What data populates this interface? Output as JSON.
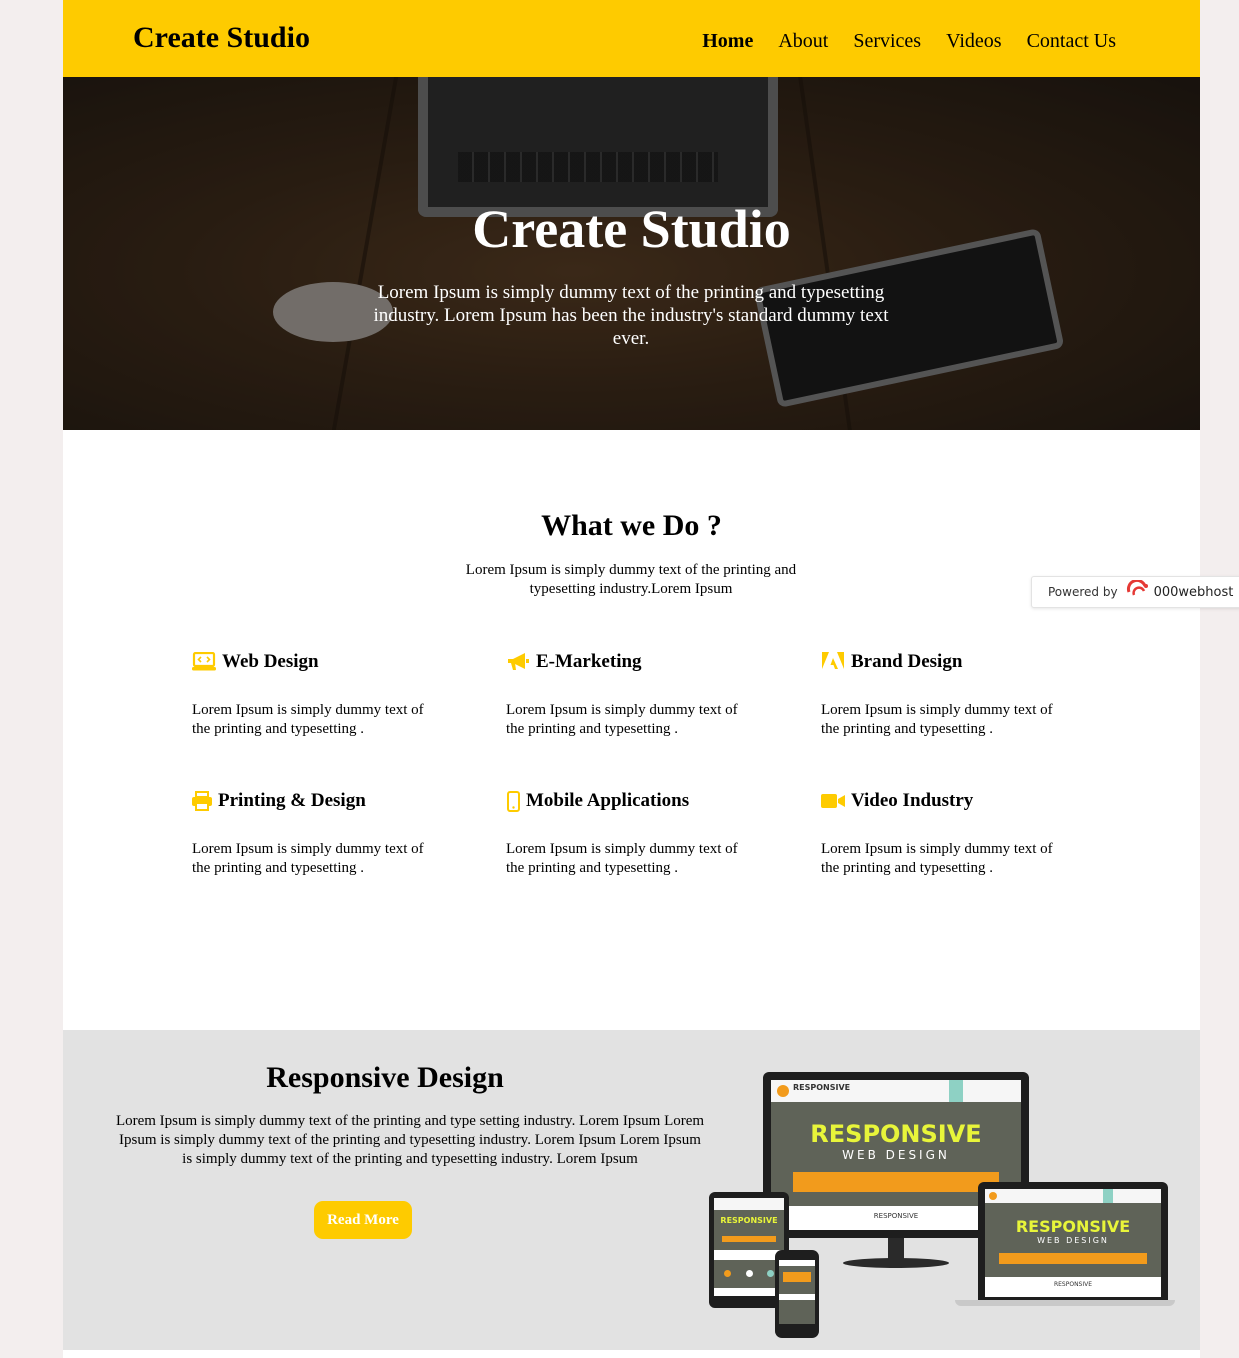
{
  "header": {
    "brand": "Create Studio",
    "nav": [
      "Home",
      "About",
      "Services",
      "Videos",
      "Contact Us"
    ],
    "active": "Home"
  },
  "hero": {
    "title": "Create Studio",
    "text": "Lorem Ipsum is simply dummy text of the printing and typesetting industry. Lorem Ipsum has been the industry's standard dummy text ever."
  },
  "what_we_do": {
    "title": "What we Do ?",
    "subtitle": "Lorem Ipsum is simply dummy text of the printing and typesetting industry.Lorem Ipsum",
    "services": [
      {
        "title": "Web Design",
        "icon": "laptop-code-icon",
        "text": "Lorem Ipsum is simply dummy text of the printing and typesetting ."
      },
      {
        "title": "E-Marketing",
        "icon": "megaphone-icon",
        "text": "Lorem Ipsum is simply dummy text of the printing and typesetting ."
      },
      {
        "title": "Brand Design",
        "icon": "adobe-icon",
        "text": "Lorem Ipsum is simply dummy text of the printing and typesetting ."
      },
      {
        "title": "Printing & Design",
        "icon": "printer-icon",
        "text": "Lorem Ipsum is simply dummy text of the printing and typesetting ."
      },
      {
        "title": "Mobile Applications",
        "icon": "mobile-phone-icon",
        "text": "Lorem Ipsum is simply dummy text of the printing and typesetting ."
      },
      {
        "title": "Video Industry",
        "icon": "video-camera-icon",
        "text": "Lorem Ipsum is simply dummy text of the printing and typesetting ."
      }
    ]
  },
  "powered": {
    "label": "Powered by",
    "logo": "000webhost"
  },
  "responsive": {
    "title": "Responsive Design",
    "text": "Lorem Ipsum is simply dummy text of the printing and type setting industry. Lorem Ipsum Lorem Ipsum is simply dummy text of the printing and typesetting industry. Lorem Ipsum Lorem Ipsum is simply dummy text of the printing and typesetting industry. Lorem Ipsum",
    "button": "Read More",
    "device_art": {
      "big": "RESPONSIVE",
      "sub": "WEB DESIGN",
      "caption": "RESPONSIVE"
    }
  },
  "colors": {
    "accent": "#fecb00",
    "page_bg": "#f3eeee",
    "section_grey": "#e2e2e2"
  }
}
